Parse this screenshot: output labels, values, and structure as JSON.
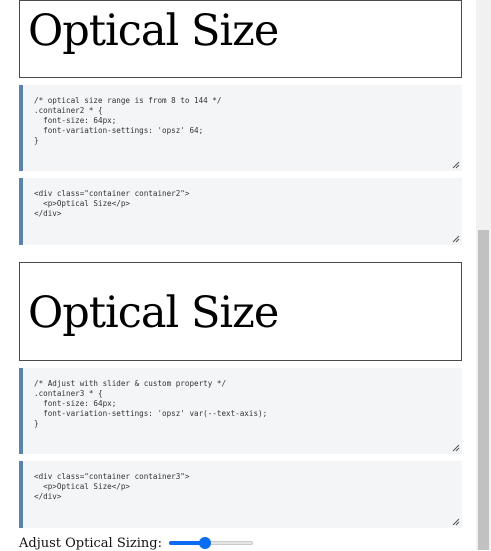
{
  "demo1": {
    "text": "Optical Size"
  },
  "css_block_2": "/* optical size range is from 8 to 144 */\n.container2 * {\n  font-size: 64px;\n  font-variation-settings: 'opsz' 64;\n}",
  "html_block_2": "<div class=\"container container2\">\n  <p>Optical Size</p>\n</div>",
  "demo2": {
    "text": "Optical Size"
  },
  "css_block_3": "/* Adjust with slider & custom property */\n.container3 * {\n  font-size: 64px;\n  font-variation-settings: 'opsz' var(--text-axis);\n}",
  "html_block_3": "<div class=\"container container3\">\n  <p>Optical Size</p>\n</div>",
  "slider": {
    "label": "Adjust Optical Sizing:",
    "fraction": 0.43
  },
  "colors": {
    "accent": "#0a6cf0",
    "code_border": "#5a84ad",
    "code_bg": "#f3f5f6"
  },
  "icons": {
    "resize": "resize-grip-icon"
  }
}
